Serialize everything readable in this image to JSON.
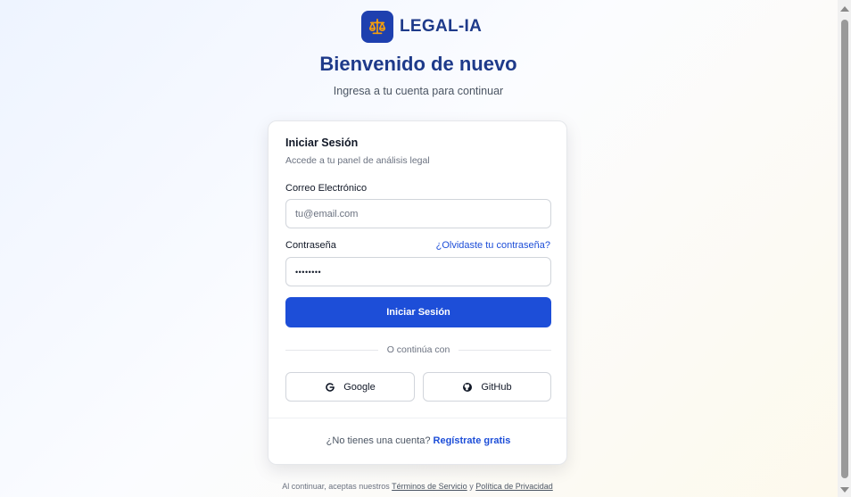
{
  "brand": {
    "name": "LEGAL-IA",
    "logo_icon": "scale-icon"
  },
  "header": {
    "title": "Bienvenido de nuevo",
    "subtitle": "Ingresa a tu cuenta para continuar"
  },
  "login_card": {
    "title": "Iniciar Sesión",
    "description": "Accede a tu panel de análisis legal",
    "email": {
      "label": "Correo Electrónico",
      "placeholder": "tu@email.com",
      "value": ""
    },
    "password": {
      "label": "Contraseña",
      "value": "••••••••",
      "forgot_link": "¿Olvidaste tu contraseña?"
    },
    "submit_label": "Iniciar Sesión",
    "divider_text": "O continúa con",
    "social": [
      {
        "label": "Google",
        "icon": "google-icon"
      },
      {
        "label": "GitHub",
        "icon": "github-icon"
      }
    ],
    "signup": {
      "prompt": "¿No tienes una cuenta?",
      "link": "Regístrate gratis"
    }
  },
  "footer": {
    "prefix": "Al continuar, aceptas nuestros",
    "terms": "Términos de Servicio",
    "conjunction": "y",
    "privacy": "Política de Privacidad"
  },
  "colors": {
    "primary": "#1d4ed8",
    "brand_dark": "#1e3a8a",
    "logo_bg": "#1e40af",
    "logo_icon": "#f59e0b"
  }
}
